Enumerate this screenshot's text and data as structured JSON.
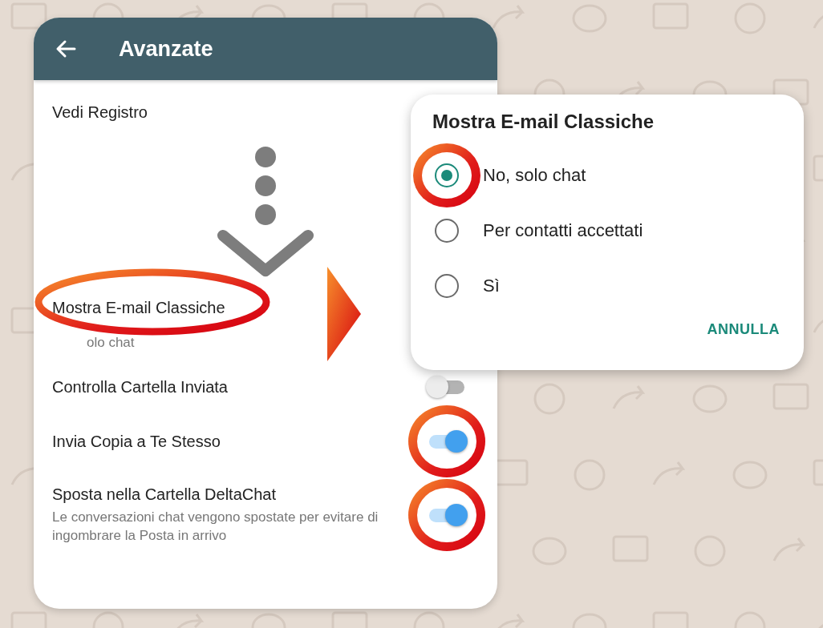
{
  "header": {
    "title": "Avanzate"
  },
  "settings": [
    {
      "kind": "plain",
      "title": "Vedi Registro"
    },
    {
      "kind": "choice",
      "title": "Mostra E-mail Classiche",
      "subtitle": "olo chat",
      "highlighted": true
    },
    {
      "kind": "switch",
      "title": "Controlla Cartella Inviata",
      "on": false,
      "highlighted": false
    },
    {
      "kind": "switch",
      "title": "Invia Copia a Te Stesso",
      "on": true,
      "highlighted": true
    },
    {
      "kind": "switch",
      "title": "Sposta nella Cartella DeltaChat",
      "subtitle": "Le conversazioni chat vengono spostate per evitare di ingombrare la Posta in arrivo",
      "on": true,
      "highlighted": true
    }
  ],
  "dialog": {
    "title": "Mostra E-mail Classiche",
    "options": [
      {
        "label": "No, solo chat",
        "selected": true,
        "highlighted": true
      },
      {
        "label": "Per contatti accettati",
        "selected": false,
        "highlighted": false
      },
      {
        "label": "Sì",
        "selected": false,
        "highlighted": false
      }
    ],
    "cancel": "ANNULLA"
  }
}
